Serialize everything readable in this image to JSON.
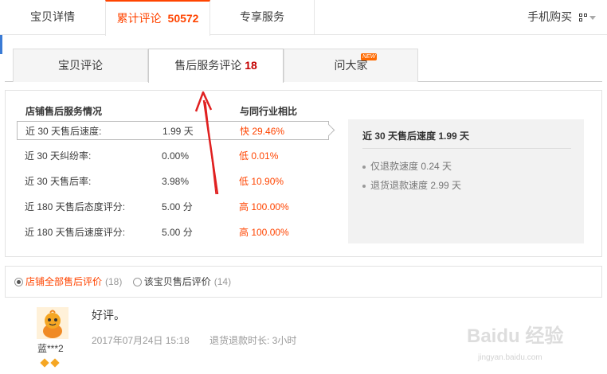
{
  "top_tabs": {
    "details": "宝贝详情",
    "reviews_label": "累计评论",
    "reviews_count": "50572",
    "service": "专享服务",
    "mobile": "手机购买"
  },
  "sub_tabs": {
    "item_reviews": "宝贝评论",
    "after_sales_label": "售后服务评论",
    "after_sales_count": "18",
    "ask": "问大家",
    "new_badge": "NEW"
  },
  "service_panel": {
    "heading_left": "店铺售后服务情况",
    "heading_right": "与同行业相比",
    "rows": [
      {
        "label": "近 30 天售后速度:",
        "value": "1.99 天",
        "compare": "快 29.46%"
      },
      {
        "label": "近 30 天纠纷率:",
        "value": "0.00%",
        "compare": "低 0.01%"
      },
      {
        "label": "近 30 天售后率:",
        "value": "3.98%",
        "compare": "低 10.90%"
      },
      {
        "label": "近 180 天售后态度评分:",
        "value": "5.00 分",
        "compare": "高 100.00%"
      },
      {
        "label": "近 180 天售后速度评分:",
        "value": "5.00 分",
        "compare": "高 100.00%"
      }
    ],
    "detail": {
      "title": "近 30 天售后速度 1.99 天",
      "items": [
        "仅退款速度 0.24 天",
        "退货退款速度 2.99 天"
      ]
    }
  },
  "filter": {
    "option1": "店铺全部售后评价",
    "option1_count": "(18)",
    "option2": "该宝贝售后评价",
    "option2_count": "(14)"
  },
  "review": {
    "username": "蓝***2",
    "text": "好评。",
    "date": "2017年07月24日 15:18",
    "duration": "退货退款时长: 3小时"
  },
  "watermark": {
    "brand": "Baidu 经验",
    "url": "jingyan.baidu.com"
  },
  "colors": {
    "accent": "#ff4400",
    "count_red": "#c40000",
    "annotation": "#e02020"
  }
}
